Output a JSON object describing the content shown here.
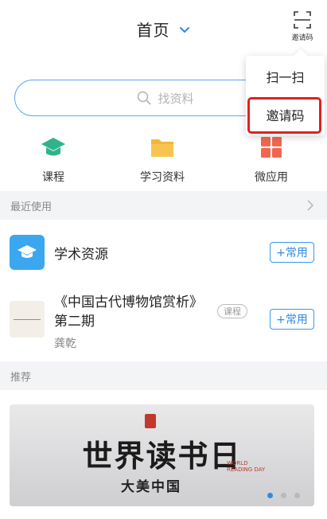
{
  "header": {
    "title": "首页",
    "scan_label": "邀请码"
  },
  "search": {
    "placeholder": "找资料"
  },
  "quick_actions": [
    {
      "label": "课程",
      "icon": "course-icon",
      "color": "#2db48a"
    },
    {
      "label": "学习资料",
      "icon": "folder-icon",
      "color": "#f4b63a"
    },
    {
      "label": "微应用",
      "icon": "apps-grid-icon",
      "color": "#f0674f"
    }
  ],
  "recent": {
    "header": "最近使用",
    "items": [
      {
        "title": "学术资源",
        "button": "+常用"
      },
      {
        "title": "《中国古代博物馆赏析》第二期",
        "tag": "课程",
        "author": "龚乾",
        "button": "+常用"
      }
    ]
  },
  "recommend": {
    "header": "推荐",
    "banner_title": "世界读书日",
    "banner_subtitle": "大美中国",
    "banner_en": "WORLD READING DAY",
    "dots": [
      true,
      false,
      false
    ]
  },
  "popup": {
    "items": [
      "扫一扫",
      "邀请码"
    ]
  },
  "colors": {
    "accent": "#2f8ae2",
    "highlight": "#e02020"
  }
}
